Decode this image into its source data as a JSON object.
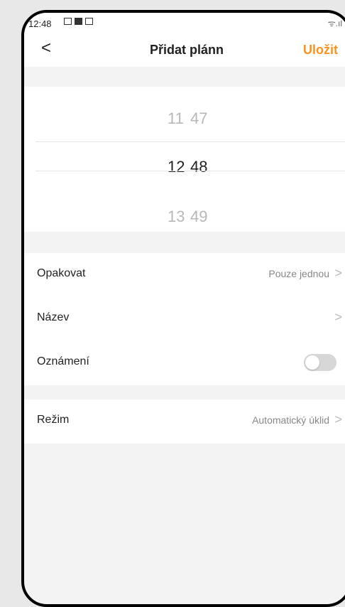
{
  "status_bar": {
    "time": "12:48",
    "right": "ᯤ.ıl"
  },
  "header": {
    "back_icon": "<",
    "title": "Přidat plánn",
    "save_label": "Uložit",
    "accent_color": "#f7931e"
  },
  "time_picker": {
    "rows": [
      {
        "hour": "11",
        "minute": "47"
      },
      {
        "hour": "12",
        "minute": "48"
      },
      {
        "hour": "13",
        "minute": "49"
      }
    ],
    "selected_index": 1
  },
  "settings": {
    "repeat": {
      "label": "Opakovat",
      "value": "Pouze jednou"
    },
    "name": {
      "label": "Název",
      "value": ""
    },
    "notification": {
      "label": "Oznámení",
      "enabled": false
    },
    "mode": {
      "label": "Režim",
      "value": "Automatický úklid"
    }
  },
  "chevron": ">"
}
